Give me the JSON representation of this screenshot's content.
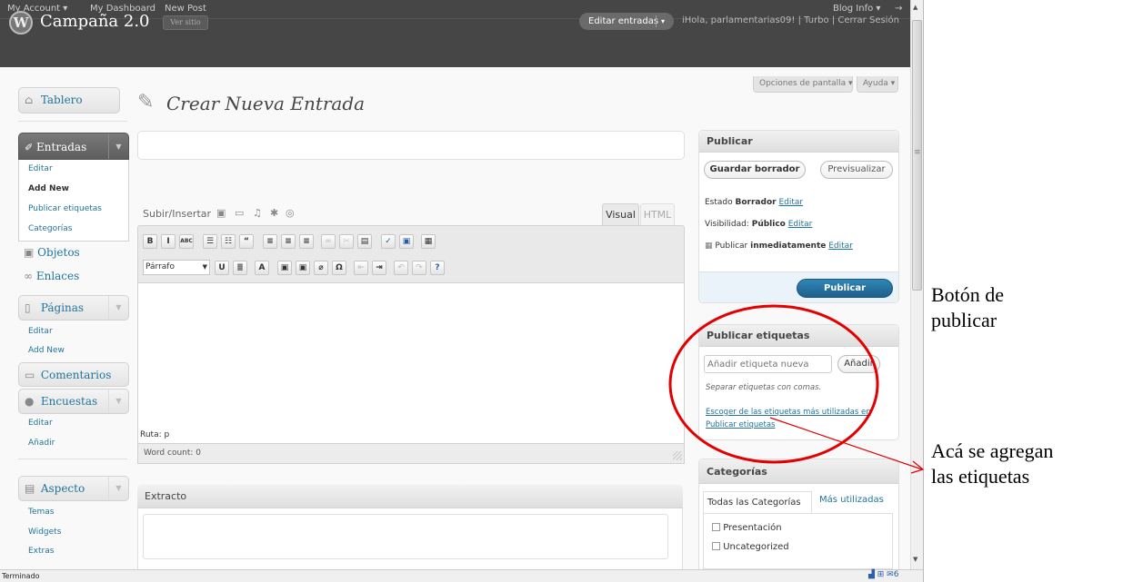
{
  "admin_bar": {
    "my_account": "My Account ▾",
    "my_dashboard": "My Dashboard",
    "new_post": "New Post",
    "blog_info": "Blog Info ▾",
    "arrow": "→"
  },
  "site": {
    "logo": "W",
    "title": "Campaña 2.0",
    "view_site": "Ver sitio",
    "edit_posts": "Editar entradas",
    "edit_posts_arrow": "▾",
    "greeting": "iHola, parlamentarias09! | Turbo | Cerrar Sesión"
  },
  "screen_options": {
    "options": "Opciones de pantalla ▾",
    "help": "Ayuda ▾"
  },
  "menu": {
    "dashboard": "Tablero",
    "posts": "Entradas",
    "posts_items": [
      "Editar",
      "Add New",
      "Publicar etiquetas",
      "Categorías"
    ],
    "media": "Objetos",
    "links": "Enlaces",
    "pages": "Páginas",
    "pages_items": [
      "Editar",
      "Add New"
    ],
    "comments": "Comentarios",
    "polls": "Encuestas",
    "polls_items": [
      "Editar",
      "Añadir"
    ],
    "appearance": "Aspecto",
    "appearance_items": [
      "Temas",
      "Widgets",
      "Extras"
    ]
  },
  "page": {
    "heading": "Crear Nueva Entrada"
  },
  "editor": {
    "upload_label": "Subir/Insertar",
    "tab_visual": "Visual",
    "tab_html": "HTML",
    "format_select": "Párrafo",
    "path": "Ruta: p",
    "word_count": "Word count: 0",
    "row1": [
      "B",
      "I",
      "ABC",
      "☰",
      "☷",
      "“",
      "≡",
      "≡",
      "≡",
      "∞",
      "✂",
      "▤",
      "✓",
      "▣",
      "▦"
    ],
    "row2": [
      "U",
      "≣",
      "A",
      "▣",
      "▣",
      "⌀",
      "Ω",
      "⇤",
      "⇥",
      "↶",
      "↷",
      "?"
    ]
  },
  "extracto": {
    "title": "Extracto"
  },
  "publish": {
    "title": "Publicar",
    "save_draft": "Guardar borrador",
    "preview": "Previsualizar",
    "status_label": "Estado",
    "status_value": "Borrador",
    "visibility_label": "Visibilidad:",
    "visibility_value": "Público",
    "publish_label": "Publicar",
    "publish_value": "inmediatamente",
    "edit": "Editar",
    "publish_button": "Publicar"
  },
  "tags": {
    "title": "Publicar etiquetas",
    "input_placeholder": "Añadir etiqueta nueva",
    "add_button": "Añadir",
    "hint": "Separar etiquetas con comas.",
    "most_used_line1": "Escoger de las etiquetas más utilizadas en",
    "most_used_line2": "Publicar etiquetas"
  },
  "categories": {
    "title": "Categorías",
    "tab_all": "Todas las Categorías",
    "tab_most_used": "Más utilizadas",
    "items": [
      "Presentación",
      "Uncategorized"
    ]
  },
  "status_bar": {
    "text": "Terminado",
    "icons": "▟ ⊞ ✉6"
  },
  "annotations": {
    "publish_button_line1": "Botón de",
    "publish_button_line2": "publicar",
    "tags_line1": "Acá se agregan",
    "tags_line2": "las etiquetas"
  },
  "colors": {
    "header_bg": "#464646",
    "link": "#21759b",
    "publish_button": "#21759b",
    "highlight_circle": "#e30000",
    "annotation_arrow": "#e30000"
  }
}
